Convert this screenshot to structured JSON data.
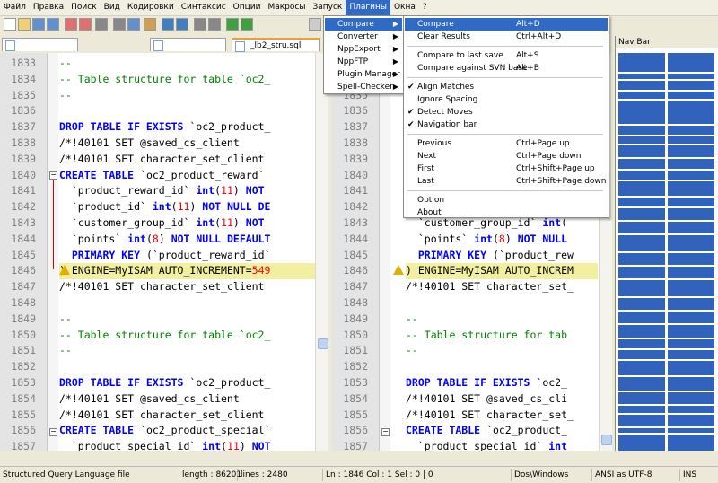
{
  "menubar": [
    "Файл",
    "Правка",
    "Поиск",
    "Вид",
    "Кодировки",
    "Синтаксис",
    "Опции",
    "Макросы",
    "Запуск",
    "Плагины",
    "Окна",
    "?"
  ],
  "tabs": {
    "left_first": "",
    "left_second": "",
    "right_active": "_lb2_stru.sql"
  },
  "left_pane": {
    "lines": [
      {
        "n": "1833",
        "html": "<span class='c'>--</span>"
      },
      {
        "n": "1834",
        "html": "<span class='c'>-- Table structure for table `oc2_</span>"
      },
      {
        "n": "1835",
        "html": "<span class='c'>--</span>"
      },
      {
        "n": "1836",
        "html": ""
      },
      {
        "n": "1837",
        "html": "<span class='k'>DROP TABLE IF EXISTS</span> `oc2_product_"
      },
      {
        "n": "1838",
        "html": "/*!40101 SET @saved_cs_client"
      },
      {
        "n": "1839",
        "html": "/*!40101 SET character_set_client"
      },
      {
        "n": "1840",
        "html": "<span class='k'>CREATE TABLE</span> `oc2_product_reward`"
      },
      {
        "n": "1841",
        "html": "  `product_reward_id` <span class='k'>int</span>(<span class='n'>11</span>) <span class='k'>NOT</span>"
      },
      {
        "n": "1842",
        "html": "  `product_id` <span class='k'>int</span>(<span class='n'>11</span>) <span class='k'>NOT NULL DE</span>"
      },
      {
        "n": "1843",
        "html": "  `customer_group_id` <span class='k'>int</span>(<span class='n'>11</span>) <span class='k'>NOT</span>"
      },
      {
        "n": "1844",
        "html": "  `points` <span class='k'>int</span>(<span class='n'>8</span>) <span class='k'>NOT NULL DEFAULT</span>"
      },
      {
        "n": "1845",
        "html": "  <span class='k'>PRIMARY KEY</span> (`product_reward_id`"
      },
      {
        "n": "1846",
        "html": ") ENGINE=MyISAM AUTO_INCREMENT=<span class='n'>549</span>"
      },
      {
        "n": "1847",
        "html": "/*!40101 SET character_set_client"
      },
      {
        "n": "1848",
        "html": ""
      },
      {
        "n": "1849",
        "html": "<span class='c'>--</span>"
      },
      {
        "n": "1850",
        "html": "<span class='c'>-- Table structure for table `oc2_</span>"
      },
      {
        "n": "1851",
        "html": "<span class='c'>--</span>"
      },
      {
        "n": "1852",
        "html": ""
      },
      {
        "n": "1853",
        "html": "<span class='k'>DROP TABLE IF EXISTS</span> `oc2_product_"
      },
      {
        "n": "1854",
        "html": "/*!40101 SET @saved_cs_client"
      },
      {
        "n": "1855",
        "html": "/*!40101 SET character_set_client"
      },
      {
        "n": "1856",
        "html": "<span class='k'>CREATE TABLE</span> `oc2_product_special`"
      },
      {
        "n": "1857",
        "html": "  `product_special_id` <span class='k'>int</span>(<span class='n'>11</span>) <span class='k'>NOT</span>"
      }
    ]
  },
  "right_pane": {
    "lines": [
      {
        "n": "1833",
        "html": ""
      },
      {
        "n": "1834",
        "html": ""
      },
      {
        "n": "1835",
        "html": ""
      },
      {
        "n": "1836",
        "html": ""
      },
      {
        "n": "1837",
        "html": ""
      },
      {
        "n": "1838",
        "html": ""
      },
      {
        "n": "1839",
        "html": ""
      },
      {
        "n": "1840",
        "html": ""
      },
      {
        "n": "1841",
        "html": ""
      },
      {
        "n": "1842",
        "html": ""
      },
      {
        "n": "1843",
        "html": "  `customer_group_id` <span class='k'>int</span>("
      },
      {
        "n": "1844",
        "html": "  `points` <span class='k'>int</span>(<span class='n'>8</span>) <span class='k'>NOT NULL</span>"
      },
      {
        "n": "1845",
        "html": "  <span class='k'>PRIMARY KEY</span> (`product_rew"
      },
      {
        "n": "1846",
        "html": ") ENGINE=MyISAM AUTO_INCREM"
      },
      {
        "n": "1847",
        "html": "/*!40101 SET character_set_"
      },
      {
        "n": "1848",
        "html": ""
      },
      {
        "n": "1849",
        "html": "<span class='c'>--</span>"
      },
      {
        "n": "1850",
        "html": "<span class='c'>-- Table structure for tab</span>"
      },
      {
        "n": "1851",
        "html": "<span class='c'>--</span>"
      },
      {
        "n": "1852",
        "html": ""
      },
      {
        "n": "1853",
        "html": "<span class='k'>DROP TABLE IF EXISTS</span> `oc2_"
      },
      {
        "n": "1854",
        "html": "/*!40101 SET @saved_cs_cli"
      },
      {
        "n": "1855",
        "html": "/*!40101 SET character_set_"
      },
      {
        "n": "1856",
        "html": "<span class='k'>CREATE TABLE</span> `oc2_product_"
      },
      {
        "n": "1857",
        "html": "  `product_special_id` <span class='k'>int</span>"
      }
    ]
  },
  "plugins_menu": [
    {
      "label": "Compare",
      "arrow": true,
      "selected": true
    },
    {
      "label": "Converter",
      "arrow": true
    },
    {
      "label": "NppExport",
      "arrow": true
    },
    {
      "label": "NppFTP",
      "arrow": true
    },
    {
      "label": "Plugin Manager",
      "arrow": true
    },
    {
      "label": "Spell-Checker",
      "arrow": true
    }
  ],
  "compare_menu": [
    {
      "label": "Compare",
      "shortcut": "Alt+D",
      "selected": true
    },
    {
      "label": "Clear Results",
      "shortcut": "Ctrl+Alt+D"
    },
    {
      "sep": true
    },
    {
      "label": "Compare to last save",
      "shortcut": "Alt+S"
    },
    {
      "label": "Compare against SVN base",
      "shortcut": "Alt+B"
    },
    {
      "sep": true
    },
    {
      "label": "Align Matches",
      "checked": true
    },
    {
      "label": "Ignore Spacing"
    },
    {
      "label": "Detect Moves",
      "checked": true
    },
    {
      "label": "Navigation bar",
      "checked": true
    },
    {
      "sep": true
    },
    {
      "label": "Previous",
      "shortcut": "Ctrl+Page up"
    },
    {
      "label": "Next",
      "shortcut": "Ctrl+Page down"
    },
    {
      "label": "First",
      "shortcut": "Ctrl+Shift+Page up"
    },
    {
      "label": "Last",
      "shortcut": "Ctrl+Shift+Page down"
    },
    {
      "sep": true
    },
    {
      "label": "Option"
    },
    {
      "label": "About"
    }
  ],
  "navbar": {
    "title": "Nav Bar",
    "color": "#3163bd"
  },
  "status": {
    "lang": "Structured Query Language file",
    "length": "length : 86201",
    "lines": "lines : 2480",
    "pos": "Ln : 1846    Col : 1    Sel : 0 | 0",
    "eol": "Dos\\Windows",
    "enc": "ANSI as UTF-8",
    "ins": "INS"
  },
  "icons": [
    "new-icon",
    "open-icon",
    "save-icon",
    "save-all-icon",
    "close-icon",
    "close-all-icon",
    "print-icon",
    "cut-icon",
    "copy-icon",
    "paste-icon",
    "undo-icon",
    "redo-icon",
    "find-icon",
    "replace-icon",
    "zoom-in-icon",
    "zoom-out-icon",
    "sync-icon"
  ]
}
